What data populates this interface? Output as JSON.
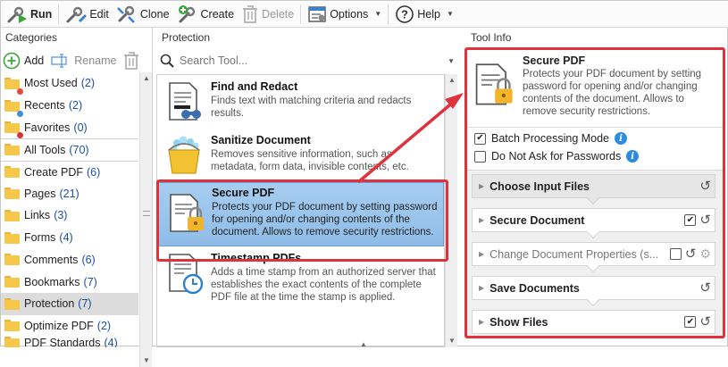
{
  "toolbar": {
    "run": "Run",
    "edit": "Edit",
    "clone": "Clone",
    "create": "Create",
    "delete": "Delete",
    "options": "Options",
    "help": "Help"
  },
  "categories": {
    "title": "Categories",
    "add_label": "Add",
    "rename_label": "Rename",
    "items": [
      {
        "name": "Most Used",
        "count": "(2)",
        "badge": "#e8453c"
      },
      {
        "name": "Recents",
        "count": "(2)",
        "badge": "#3a8fd8"
      },
      {
        "name": "Favorites",
        "count": "(0)",
        "badge": "#d8333a"
      },
      {
        "name": "All Tools",
        "count": "(70)"
      },
      {
        "name": "Create PDF",
        "count": "(6)"
      },
      {
        "name": "Pages",
        "count": "(21)"
      },
      {
        "name": "Links",
        "count": "(3)"
      },
      {
        "name": "Forms",
        "count": "(4)"
      },
      {
        "name": "Comments",
        "count": "(6)"
      },
      {
        "name": "Bookmarks",
        "count": "(7)"
      },
      {
        "name": "Protection",
        "count": "(7)"
      },
      {
        "name": "Optimize PDF",
        "count": "(2)"
      },
      {
        "name": "PDF Standards",
        "count": "(4)"
      }
    ]
  },
  "protection": {
    "title": "Protection",
    "search_placeholder": "Search Tool...",
    "tools": [
      {
        "name": "Find and Redact",
        "desc": "Finds text with matching criteria and redacts results."
      },
      {
        "name": "Sanitize Document",
        "desc": "Removes sensitive information, such as metadata, form data, invisible contents, etc."
      },
      {
        "name": "Secure PDF",
        "desc": "Protects your PDF document by setting password for opening and/or changing contents of the document. Allows to remove security restrictions."
      },
      {
        "name": "Timestamp PDFs",
        "desc": "Adds a time stamp from an authorized server that establishes the exact contents of the complete PDF file at the time the stamp is applied."
      }
    ]
  },
  "tool_info": {
    "title": "Tool Info",
    "tool_name": "Secure PDF",
    "tool_desc": "Protects your PDF document by setting password for opening and/or changing contents of the document. Allows to remove security restrictions.",
    "batch_label": "Batch Processing Mode",
    "no_ask_label": "Do Not Ask for Passwords",
    "steps": [
      {
        "label": "Choose Input Files"
      },
      {
        "label": "Secure Document"
      },
      {
        "label": "Change Document Properties (s..."
      },
      {
        "label": "Save Documents"
      },
      {
        "label": "Show Files"
      }
    ]
  },
  "colors": {
    "highlight_red": "#e0323d",
    "selection_blue": "#8fbde8",
    "count_blue": "#1a4ea8"
  }
}
